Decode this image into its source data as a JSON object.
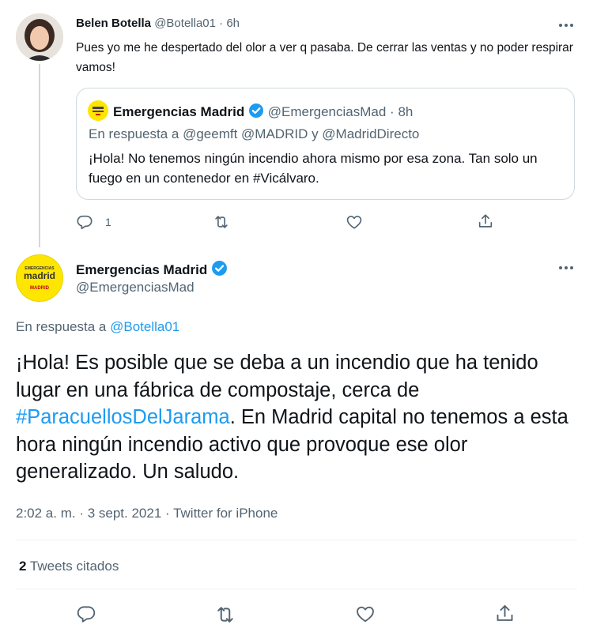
{
  "reply_tweet": {
    "author_name": "Belen Botella",
    "author_handle": "@Botella01",
    "time": "6h",
    "text": "Pues yo me he despertado del olor a ver q pasaba. De cerrar las ventas y no poder respirar vamos!",
    "reply_count": "1"
  },
  "quoted_tweet": {
    "author_name": "Emergencias Madrid",
    "author_handle": "@EmergenciasMad",
    "time": "8h",
    "reply_prefix": "En respuesta a",
    "reply_to": "@geemft @MADRID y @MadridDirecto",
    "text": "¡Hola! No tenemos ningún incendio ahora mismo por esa zona. Tan solo un fuego en un contenedor en #Vicálvaro."
  },
  "main_tweet": {
    "author_name": "Emergencias Madrid",
    "author_handle": "@EmergenciasMad",
    "reply_prefix": "En respuesta a",
    "reply_to": "@Botella01",
    "text_before": "¡Hola! Es posible que se deba a un incendio que ha tenido lugar en una fábrica de compostaje, cerca de ",
    "hashtag": "#ParacuellosDelJarama",
    "text_after": ". En Madrid capital no tenemos a esta hora ningún incendio activo que provoque ese olor generalizado.  Un saludo.",
    "timestamp": "2:02 a. m. · 3 sept. 2021 · Twitter for iPhone",
    "quote_count": "2",
    "quote_label": "Tweets citados"
  },
  "avatar_logo": {
    "line1": "EMERGENCIAS",
    "line2": "madrid",
    "line3": "MADRID"
  },
  "colors": {
    "accent": "#1d9bf0",
    "muted": "#536471",
    "logo_yellow": "#ffe600"
  }
}
